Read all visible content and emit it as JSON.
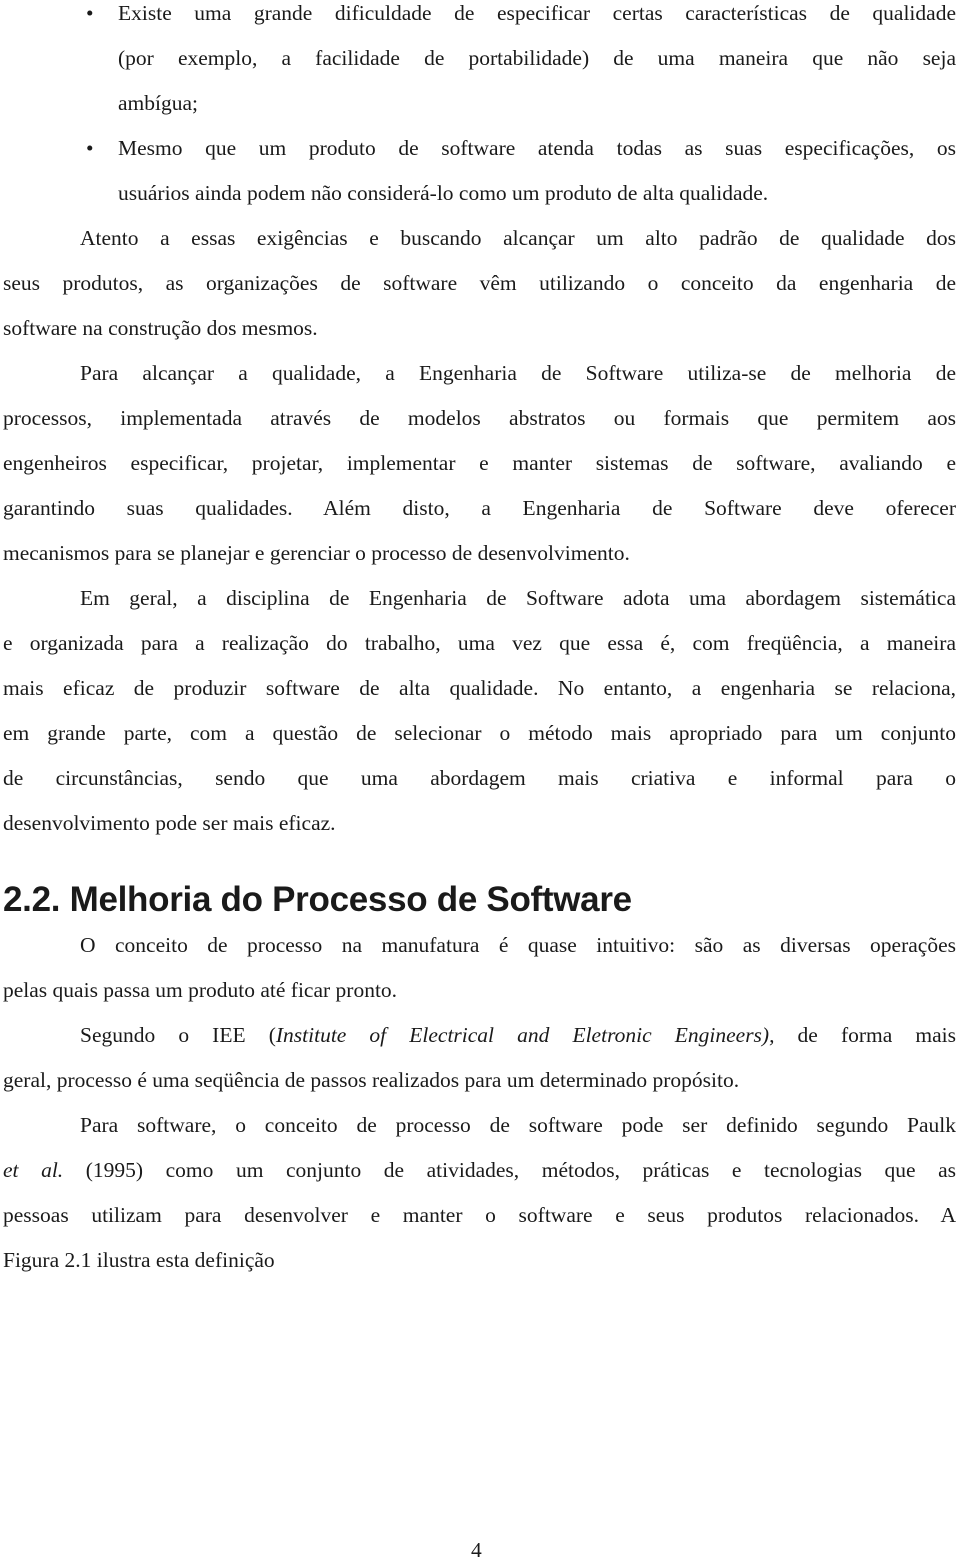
{
  "bullet_glyph": "•",
  "bullets": [
    {
      "lines": [
        "Existe uma grande dificuldade de especificar certas características de qualidade",
        "(por exemplo, a facilidade de portabilidade) de uma maneira que não seja",
        "ambígua;"
      ]
    },
    {
      "lines": [
        "Mesmo que um produto de software atenda todas as suas especificações, os",
        "usuários ainda podem não considerá-lo como um produto de alta qualidade."
      ]
    }
  ],
  "paragraphs_before": [
    {
      "lines": [
        "Atento a essas exigências e buscando alcançar um alto padrão de qualidade dos",
        "seus produtos, as organizações de software vêm utilizando o conceito da engenharia de",
        "software na construção dos mesmos."
      ]
    },
    {
      "lines": [
        "Para alcançar a qualidade, a Engenharia de Software utiliza-se de melhoria de",
        "processos, implementada através de modelos abstratos ou formais que permitem aos",
        "engenheiros especificar, projetar, implementar e manter sistemas de software, avaliando e",
        "garantindo suas qualidades. Além disto, a Engenharia de Software deve oferecer",
        "mecanismos para se planejar e gerenciar o processo de desenvolvimento."
      ]
    },
    {
      "lines": [
        "Em geral, a disciplina de Engenharia de Software adota uma abordagem sistemática",
        "e organizada para a realização do trabalho, uma vez que essa é, com freqüência, a maneira",
        "mais eficaz de produzir software de alta qualidade. No entanto, a engenharia se relaciona,",
        "em grande parte, com a questão de selecionar o método mais apropriado para um conjunto",
        "de circunstâncias, sendo que uma abordagem mais criativa e informal para o",
        "desenvolvimento pode ser mais eficaz."
      ]
    }
  ],
  "section_heading": "2.2. Melhoria do Processo de Software",
  "paragraphs_after": [
    {
      "lines": [
        "O conceito de processo na manufatura é quase intuitivo: são as diversas operações",
        "pelas quais passa um produto até ficar pronto."
      ]
    },
    {
      "line1": {
        "a": "Segundo o IEE (",
        "b": "Institute of Electrical and Eletronic Engineers),",
        "c": " de forma mais"
      },
      "lines": [
        "",
        "geral, processo é uma seqüência de passos realizados para um determinado propósito."
      ]
    },
    {
      "lines": [
        "Para software, o conceito de processo de software pode ser definido segundo Paulk",
        "",
        "pessoas utilizam para desenvolver e manter o software e seus produtos relacionados. A",
        "Figura 2.1 ilustra esta definição"
      ],
      "line2": {
        "a": "et al.",
        "b": " (1995) como um conjunto de atividades, métodos, práticas e tecnologias que as"
      }
    }
  ],
  "page_number": "4"
}
